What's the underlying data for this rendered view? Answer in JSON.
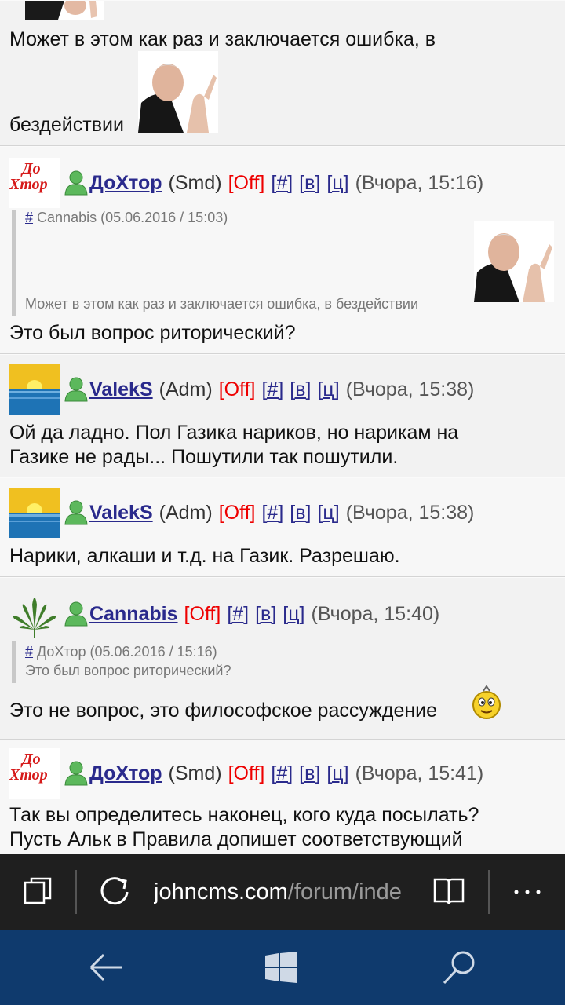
{
  "posts": [
    {
      "message_lines": [
        "Может в этом как раз и заключается ошибка, в",
        "бездействии"
      ]
    },
    {
      "avatar_text": [
        "До",
        "Хтор"
      ],
      "nick": "ДоХтор",
      "role": "(Smd)",
      "status": "[Off]",
      "links": [
        "[#]",
        "[в]",
        "[ц]"
      ],
      "time": "(Вчора, 15:16)",
      "quote": {
        "link": "#",
        "header": "Cannabis (05.06.2016 / 15:03)",
        "text": "Может в этом как раз и заключается ошибка, в бездействии"
      },
      "message": "Это был вопрос риторический?"
    },
    {
      "nick": "ValekS",
      "role": "(Adm)",
      "status": "[Off]",
      "links": [
        "[#]",
        "[в]",
        "[ц]"
      ],
      "time": "(Вчора, 15:38)",
      "message_lines": [
        "Ой да ладно. Пол Газика нариков, но нарикам на",
        "Газике не рады... Пошутили так пошутили."
      ]
    },
    {
      "nick": "ValekS",
      "role": "(Adm)",
      "status": "[Off]",
      "links": [
        "[#]",
        "[в]",
        "[ц]"
      ],
      "time": "(Вчора, 15:38)",
      "message": "Нарики, алкаши и т.д. на Газик. Разрешаю."
    },
    {
      "nick": "Cannabis",
      "status": "[Off]",
      "links": [
        "[#]",
        "[в]",
        "[ц]"
      ],
      "time": "(Вчора, 15:40)",
      "quote": {
        "link": "#",
        "header": "ДоХтор (05.06.2016 / 15:16)",
        "text": "Это был вопрос риторический?"
      },
      "message": "Это не вопрос, это философское рассуждение"
    },
    {
      "avatar_text": [
        "До",
        "Хтор"
      ],
      "nick": "ДоХтор",
      "role": "(Smd)",
      "status": "[Off]",
      "links": [
        "[#]",
        "[в]",
        "[ц]"
      ],
      "time": "(Вчора, 15:41)",
      "message_lines": [
        "Так вы определитесь наконец, кого куда посылать?",
        "Пусть Альк в Правила допишет соответствующий"
      ]
    }
  ],
  "browser": {
    "url_host": "johncms.com",
    "url_path": "/forum/inde",
    "icons": [
      "tabs-icon",
      "refresh-icon",
      "reading-view-icon",
      "more-icon"
    ]
  },
  "navbar": {
    "icons": [
      "back-icon",
      "windows-start-icon",
      "search-icon"
    ]
  },
  "colors": {
    "nick": "#2a2a8c",
    "status_off": "#ee0000",
    "toolbar_bg": "#1f1f1f",
    "navbar_bg": "#0f3a6d"
  }
}
